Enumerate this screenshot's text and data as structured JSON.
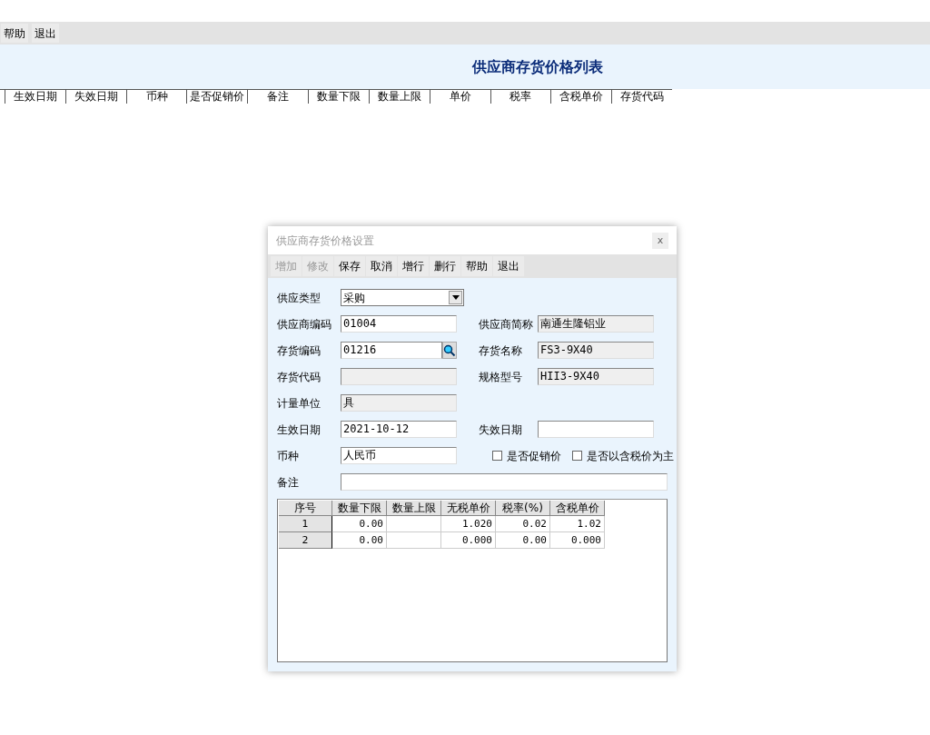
{
  "toolbar": [
    {
      "label": "帮助"
    },
    {
      "label": "退出"
    }
  ],
  "page_title": "供应商存货价格列表",
  "list_columns": [
    "生效日期",
    "失效日期",
    "币种",
    "是否促销价",
    "备注",
    "数量下限",
    "数量上限",
    "单价",
    "税率",
    "含税单价",
    "存货代码"
  ],
  "dialog": {
    "title": "供应商存货价格设置",
    "close": "x",
    "buttons": [
      {
        "label": "增加",
        "disabled": true
      },
      {
        "label": "修改",
        "disabled": true
      },
      {
        "label": "保存",
        "disabled": false
      },
      {
        "label": "取消",
        "disabled": false
      },
      {
        "label": "增行",
        "disabled": false
      },
      {
        "label": "删行",
        "disabled": false
      },
      {
        "label": "帮助",
        "disabled": false
      },
      {
        "label": "退出",
        "disabled": false
      }
    ],
    "rows": [
      [
        {
          "kind": "select",
          "label": "供应类型",
          "value": "采购"
        }
      ],
      [
        {
          "kind": "text",
          "label": "供应商编码",
          "value": "01004"
        },
        {
          "kind": "readonly",
          "label": "供应商简称",
          "value": "南通生隆铝业"
        }
      ],
      [
        {
          "kind": "lookup",
          "label": "存货编码",
          "value": "01216"
        },
        {
          "kind": "readonly",
          "label": "存货名称",
          "value": "FS3-9X40"
        }
      ],
      [
        {
          "kind": "readonly",
          "label": "存货代码"
        },
        {
          "kind": "readonly",
          "label": "规格型号",
          "value": "HII3-9X40"
        }
      ],
      [
        {
          "kind": "readonly",
          "label": "计量单位",
          "value": "具"
        }
      ],
      [
        {
          "kind": "text",
          "label": "生效日期",
          "value": "2021-10-12"
        },
        {
          "kind": "text",
          "label": "失效日期"
        }
      ],
      [
        {
          "kind": "text",
          "label": "币种",
          "value": "人民币"
        },
        {
          "kind": "checks",
          "items": [
            {
              "label": "是否促销价",
              "checked": false
            },
            {
              "label": "是否以含税价为主",
              "checked": false
            }
          ]
        }
      ],
      [
        {
          "kind": "wide",
          "label": "备注"
        }
      ]
    ],
    "grid": {
      "columns": [
        "序号",
        "数量下限",
        "数量上限",
        "无税单价",
        "税率(%)",
        "含税单价"
      ],
      "rows": [
        [
          "1",
          "0.00",
          "",
          "1.020",
          "0.02",
          "1.02"
        ],
        [
          "2",
          "0.00",
          "",
          "0.000",
          "0.00",
          "0.000"
        ]
      ]
    }
  }
}
